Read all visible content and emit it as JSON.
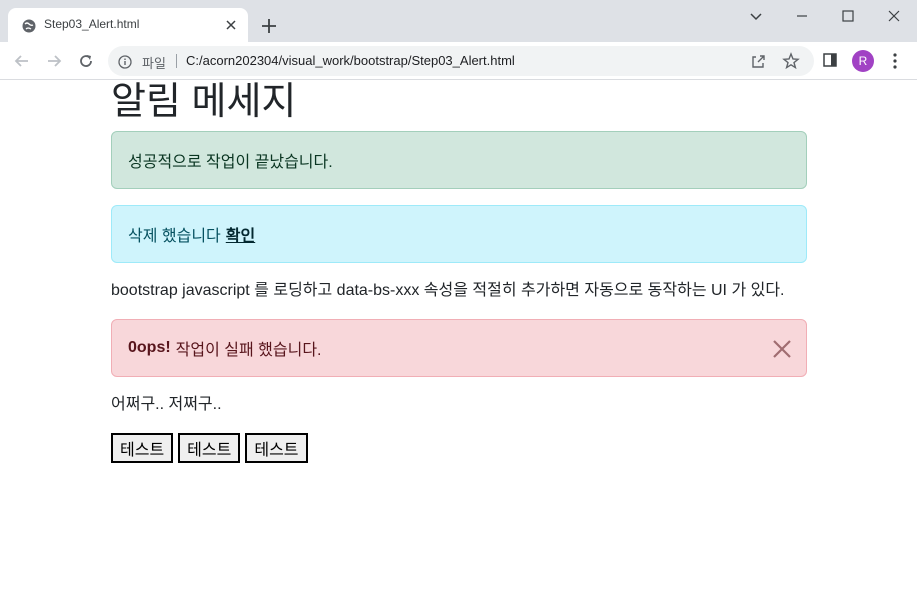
{
  "browser": {
    "tab": {
      "title": "Step03_Alert.html"
    },
    "omnibox": {
      "scheme_label": "파일",
      "url": "C:/acorn202304/visual_work/bootstrap/Step03_Alert.html"
    },
    "profile_initial": "R"
  },
  "page": {
    "heading": "알림 메세지",
    "alerts": {
      "success": {
        "text": "성공적으로 작업이 끝났습니다."
      },
      "info": {
        "text": "삭제 했습니다",
        "link": "확인"
      },
      "danger": {
        "strong": "0ops!",
        "text": "작업이 실패 했습니다."
      }
    },
    "description": "bootstrap javascript 를 로딩하고 data-bs-xxx 속성을 적절히 추가하면 자동으로 동작하는 UI 가 있다.",
    "note": "어쩌구.. 저쩌구..",
    "buttons": [
      "테스트",
      "테스트",
      "테스트"
    ]
  },
  "colors": {
    "success_bg": "#d1e7dd",
    "info_bg": "#cff4fc",
    "danger_bg": "#f8d7da",
    "avatar": "#a142c4"
  },
  "icons": [
    "globe-icon",
    "close-icon",
    "plus-icon",
    "chevron-down-icon",
    "minimize-icon",
    "maximize-icon",
    "window-close-icon",
    "back-arrow-icon",
    "forward-arrow-icon",
    "reload-icon",
    "info-icon",
    "share-icon",
    "star-icon",
    "side-panel-icon",
    "kebab-menu-icon"
  ]
}
